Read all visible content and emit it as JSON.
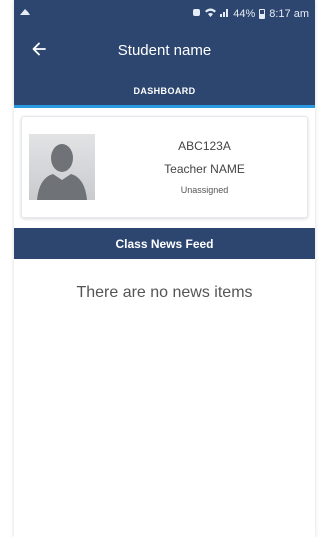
{
  "statusbar": {
    "left_icon": "notification-icon",
    "battery": "44%",
    "time": "8:17 am"
  },
  "appbar": {
    "title": "Student name",
    "back_icon": "back-arrow-icon"
  },
  "tabs": [
    {
      "label": "DASHBOARD",
      "selected": true
    }
  ],
  "profile": {
    "code": "ABC123A",
    "teacher": "Teacher NAME",
    "status": "Unassigned",
    "avatar_icon": "person-avatar-icon"
  },
  "news": {
    "header": "Class News Feed",
    "empty_message": "There are no news items"
  },
  "colors": {
    "primary": "#2c466f",
    "accent": "#2a9be3"
  }
}
